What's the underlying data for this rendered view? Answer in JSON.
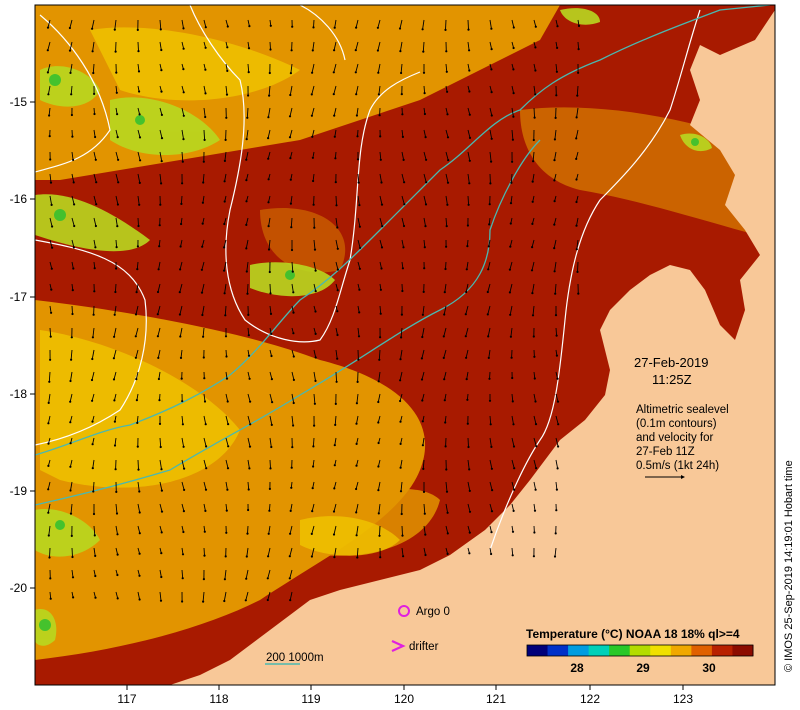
{
  "map": {
    "date": "27-Feb-2019",
    "time": "11:25Z",
    "x_axis_ticks": [
      "117",
      "118",
      "119",
      "120",
      "121",
      "122",
      "123"
    ],
    "y_axis_ticks": [
      "-15",
      "-16",
      "-17",
      "-18",
      "-19",
      "-20"
    ],
    "annotation_lines": [
      "Altimetric sealevel",
      "(0.1m contours)",
      "and velocity for",
      "27-Feb 11Z",
      "0.5m/s (1kt 24h)"
    ],
    "legend": {
      "argo_label": "Argo 0",
      "drifter_label": "drifter",
      "isobath_label": "200  1000m"
    },
    "colorbar": {
      "title": "Temperature (°C) NOAA 18 18% ql>=4",
      "tick_labels": [
        "28",
        "29",
        "30"
      ],
      "colors": [
        "#00007a",
        "#0030c8",
        "#009ce0",
        "#00d0b8",
        "#28c828",
        "#b4dc00",
        "#f0e000",
        "#f0a800",
        "#e06000",
        "#b82000",
        "#8c0c00"
      ]
    },
    "credit": "© IMOS 25-Sep-2019 14:19:01 Hobart time",
    "colors": {
      "sst_base": "#a81a00",
      "sst_warm": "#e8a000",
      "sst_cool": "#b8d820",
      "land": "#f8c898",
      "isobath_200": "#4ab8b0",
      "contour": "#ffffff",
      "argo": "#e020e0",
      "drifter": "#e020e0"
    }
  }
}
